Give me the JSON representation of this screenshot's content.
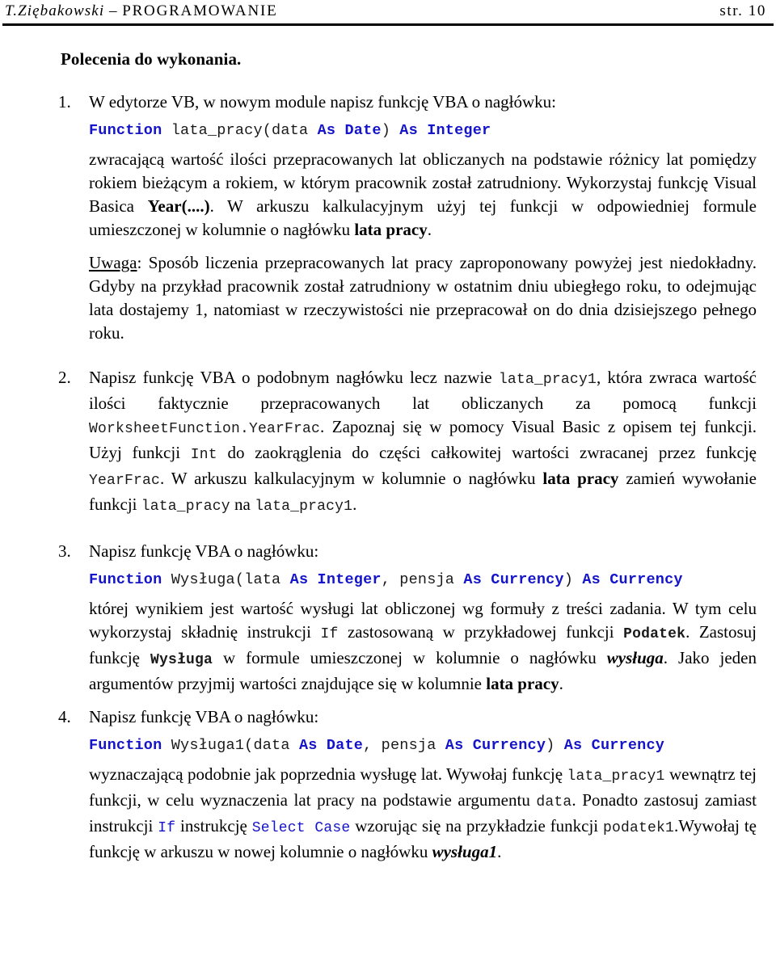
{
  "header": {
    "author": "T.Ziębakowski",
    "separator": "–",
    "title": "PROGRAMOWANIE",
    "page_label": "str. 10"
  },
  "section": {
    "title": "Polecenia do wykonania."
  },
  "tasks": [
    {
      "marker": "1.",
      "lead": "W edytorze VB, w nowym module napisz funkcję VBA o nagłówku:",
      "code": {
        "tokens": [
          {
            "t": "Function",
            "style": "kw"
          },
          {
            "t": " lata_pracy(data ",
            "style": "id"
          },
          {
            "t": "As Date",
            "style": "kw"
          },
          {
            "t": ")",
            "style": "id"
          },
          {
            "t": " As Integer",
            "style": "kw"
          }
        ]
      },
      "body_lines": [
        "zwracającą wartość ilości przepracowanych lat obliczanych na podstawie różnicy lat pomiędzy rokiem bieżącym a rokiem, w którym pracownik został zatrudniony. Wykorzystaj funkcję Visual Basica ",
        "Year(....)",
        ". W arkuszu kalkulacyjnym użyj tej funkcji w odpowiedniej formule umieszczonej w kolumnie o nagłówku ",
        "lata pracy",
        "."
      ],
      "note_label": "Uwaga",
      "note_text": ": Sposób liczenia przepracowanych lat pracy zaproponowany powyżej jest niedokładny. Gdyby na przykład pracownik został zatrudniony w ostatnim dniu ubiegłego roku, to odejmując lata dostajemy 1, natomiast w rzeczywistości nie przepracował on do dnia dzisiejszego pełnego roku."
    },
    {
      "marker": "2.",
      "parts": {
        "p1": "Napisz funkcję VBA o podobnym nagłówku lecz nazwie ",
        "c1": "lata_pracy1",
        "p2": ", która zwraca wartość ilości faktycznie przepracowanych lat obliczanych za pomocą funkcji ",
        "c2": "WorksheetFunction.YearFrac",
        "p3": ". Zapoznaj się w pomocy Visual Basic z opisem tej funkcji. Użyj funkcji ",
        "c3": "Int",
        "p4": " do zaokrąglenia do części całkowitej wartości zwracanej przez funkcję ",
        "c4": "YearFrac",
        "p5": ". W arkuszu kalkulacyjnym w kolumnie o nagłówku ",
        "b1": "lata pracy",
        "p6": " zamień wywołanie funkcji ",
        "c5": "lata_pracy",
        "p7": " na ",
        "c6": "lata_pracy1",
        "p8": "."
      }
    },
    {
      "marker": "3.",
      "lead": "Napisz funkcję VBA o nagłówku:",
      "code": {
        "tokens": [
          {
            "t": "Function",
            "style": "kw"
          },
          {
            "t": " Wysługa(lata ",
            "style": "id"
          },
          {
            "t": "As Integer",
            "style": "kw"
          },
          {
            "t": ", pensja ",
            "style": "id"
          },
          {
            "t": "As Currency",
            "style": "kw"
          },
          {
            "t": ")",
            "style": "id"
          },
          {
            "t": " As Currency",
            "style": "kw"
          }
        ]
      },
      "parts": {
        "p1": "której  wynikiem jest wartość wysługi lat obliczonej wg formuły z treści zadania. W tym celu wykorzystaj składnię instrukcji ",
        "c1": "If",
        "p2": " zastosowaną w przykładowej funkcji ",
        "c2": "Podatek",
        "p3": ". Zastosuj funkcję  ",
        "c3": "Wysługa",
        "p4": " w formule umieszczonej w kolumnie o nagłówku ",
        "b1": "wysługa",
        "p5": ". Jako jeden argumentów przyjmij wartości znajdujące się w kolumnie ",
        "b2": "lata pracy",
        "p6": "."
      }
    },
    {
      "marker": "4.",
      "lead": "Napisz funkcję VBA o nagłówku:",
      "code": {
        "tokens": [
          {
            "t": "Function",
            "style": "kw"
          },
          {
            "t": " Wysługa1(data ",
            "style": "id"
          },
          {
            "t": "As Date",
            "style": "kw"
          },
          {
            "t": ", pensja ",
            "style": "id"
          },
          {
            "t": "As Currency",
            "style": "kw"
          },
          {
            "t": ")",
            "style": "id"
          },
          {
            "t": " As Currency",
            "style": "kw"
          }
        ]
      },
      "parts": {
        "p1": "wyznaczającą podobnie jak poprzednia wysługę lat. Wywołaj funkcję ",
        "c1": "lata_pracy1",
        "p2": " wewnątrz tej funkcji, w celu wyznaczenia lat pracy na podstawie argumentu ",
        "c2": "data",
        "p3": ". Ponadto zastosuj zamiast instrukcji ",
        "c3": "If",
        "p4": " instrukcję ",
        "c4": "Select Case",
        "p5": " wzorując się na przykładzie funkcji ",
        "c5": "podatek1",
        "p6": ".Wywołaj tę funkcję w arkuszu w nowej kolumnie o nagłówku ",
        "b1": "wysługa1",
        "p7": "."
      }
    }
  ],
  "colors": {
    "code_keyword": "#1414c8",
    "text": "#000000",
    "rule": "#000000"
  }
}
